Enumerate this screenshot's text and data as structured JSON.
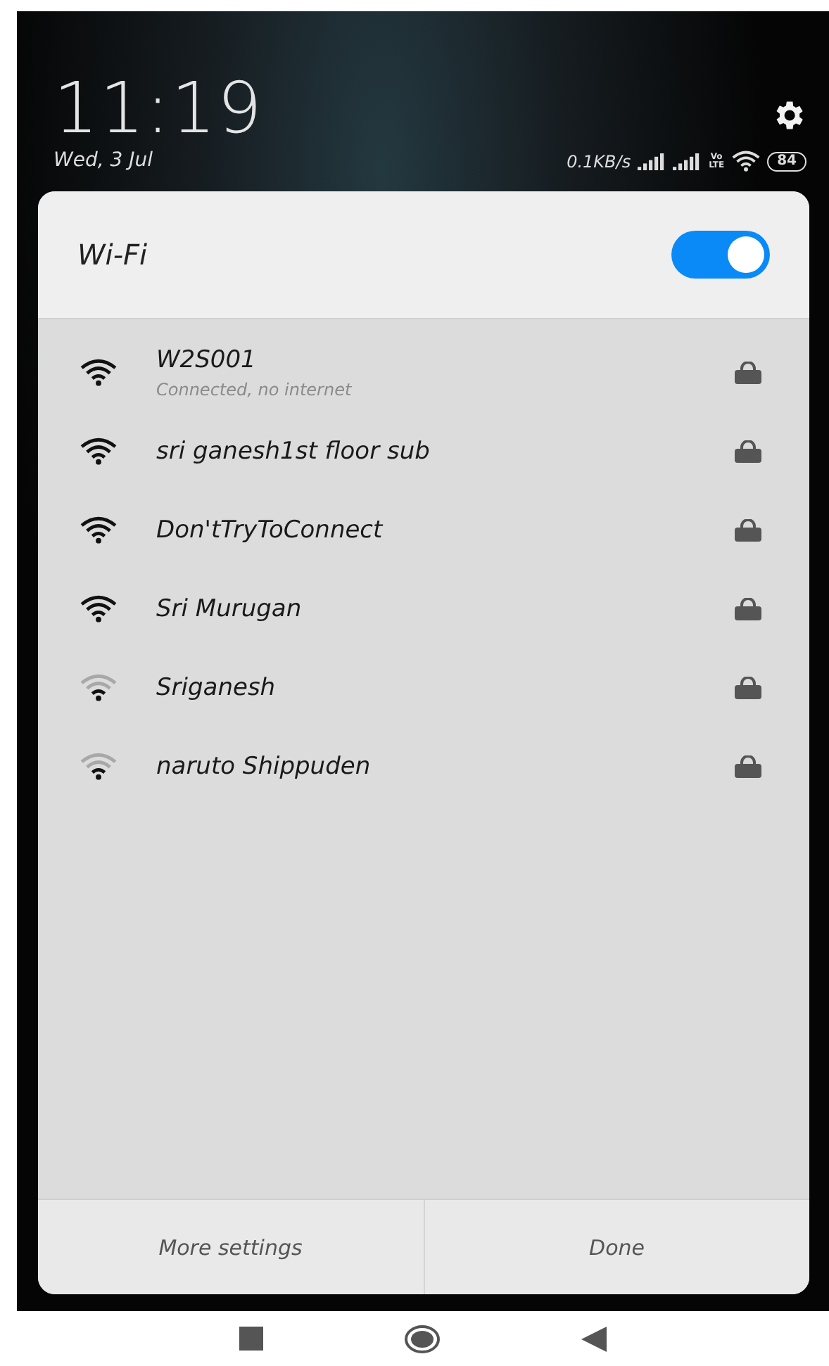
{
  "status": {
    "time": "11:19",
    "date": "Wed, 3 Jul",
    "speed": "0.1KB/s",
    "volte": "Vo LTE",
    "battery": "84"
  },
  "panel": {
    "title": "Wi-Fi",
    "on": true
  },
  "networks": [
    {
      "name": "W2S001",
      "detail": "Connected, no internet",
      "kind": "strong",
      "locked": true
    },
    {
      "name": "sri ganesh1st floor sub",
      "kind": "strong",
      "locked": true
    },
    {
      "name": "Don'tTryToConnect",
      "kind": "strong",
      "locked": true
    },
    {
      "name": "Sri Murugan",
      "kind": "strong",
      "locked": true
    },
    {
      "name": "Sriganesh",
      "kind": "weak",
      "locked": true
    },
    {
      "name": "naruto Shippuden",
      "kind": "weak",
      "locked": true
    }
  ],
  "footer": [
    "More settings",
    "Done"
  ]
}
